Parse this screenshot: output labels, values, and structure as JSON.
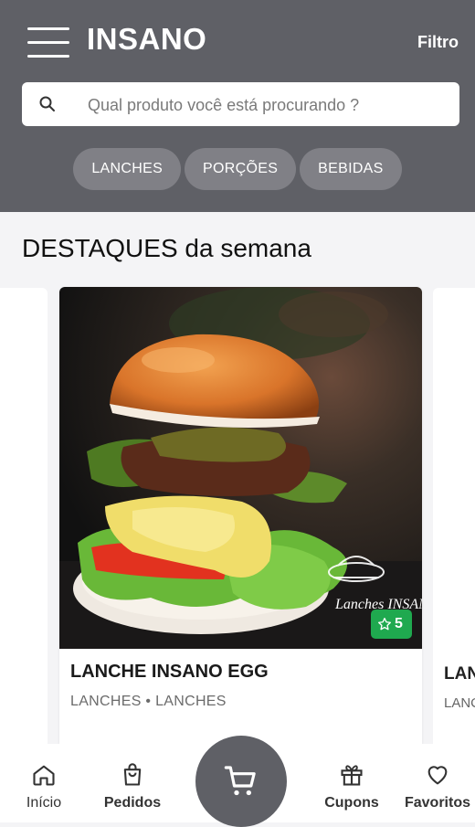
{
  "header": {
    "title": "INSANO",
    "filter_label": "Filtro",
    "search_placeholder": "Qual produto você está procurando ?",
    "categories": [
      "LANCHES",
      "PORÇÕES",
      "BEBIDAS"
    ]
  },
  "section": {
    "title": "DESTAQUES da semana"
  },
  "featured": [
    {
      "name": "LANCHE INSANO EGG",
      "category": "LANCHES • LANCHES",
      "rating": "5",
      "logo_text": "Lanches INSANO"
    },
    {
      "name": "LAN",
      "category": "LANC"
    }
  ],
  "bottom_nav": {
    "items": [
      {
        "label": "Início",
        "icon": "home-icon"
      },
      {
        "label": "Pedidos",
        "icon": "shopping-bag-icon"
      },
      {
        "label": "Cupons",
        "icon": "gift-icon"
      },
      {
        "label": "Favoritos",
        "icon": "heart-icon"
      }
    ],
    "cart_icon": "cart-icon"
  },
  "colors": {
    "header_bg": "#5f6066",
    "chip_bg": "#808086",
    "rating_bg": "#1fa94f",
    "page_bg": "#f4f4f6"
  }
}
